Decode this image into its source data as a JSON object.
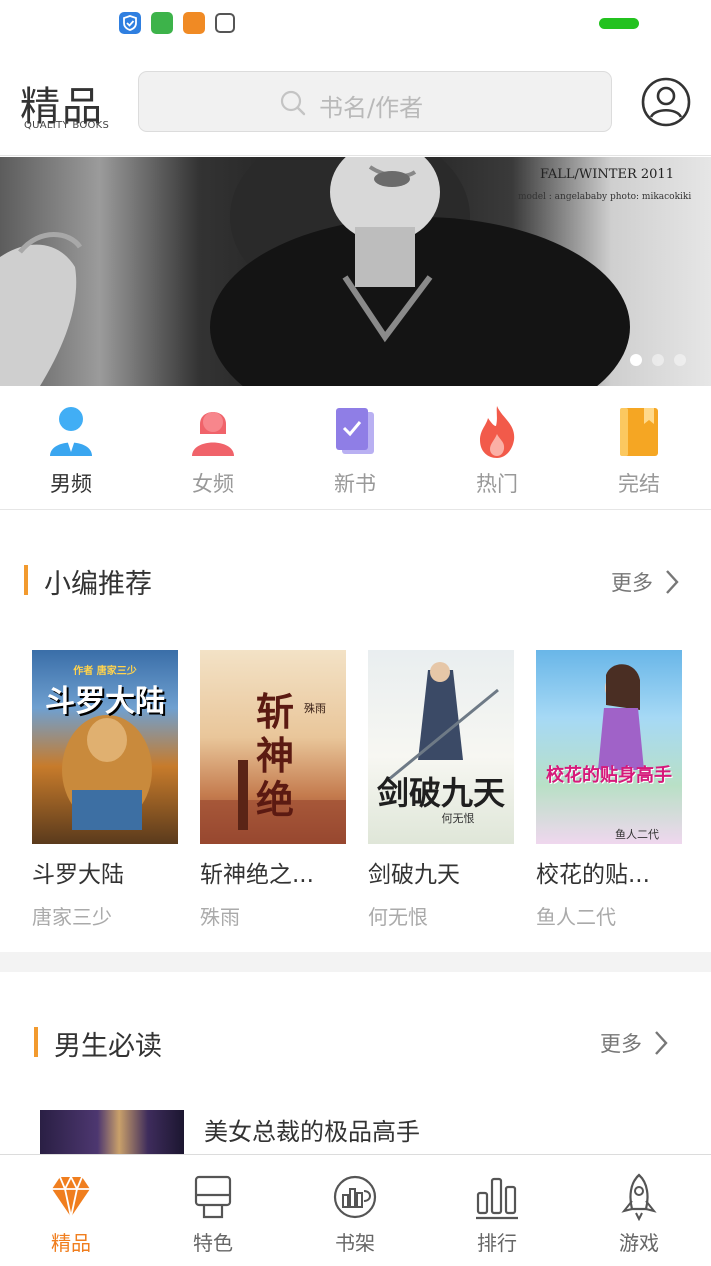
{
  "header": {
    "logo_text": "精品",
    "logo_subtitle": "QUALITY BOOKS",
    "search_placeholder": "书名/作者"
  },
  "banner": {
    "text_line1": "FALL/WINTER 2011",
    "text_line2": "model : angelababy    photo: mikacokiki",
    "slide_count": 3,
    "active_slide": 1
  },
  "categories": [
    {
      "label": "男频",
      "icon": "male-user-icon",
      "color": "#3aa6f0"
    },
    {
      "label": "女频",
      "icon": "female-user-icon",
      "color": "#f0636a"
    },
    {
      "label": "新书",
      "icon": "new-book-icon",
      "color": "#8f7ee6"
    },
    {
      "label": "热门",
      "icon": "flame-icon",
      "color": "#f25a4a"
    },
    {
      "label": "完结",
      "icon": "finished-book-icon",
      "color": "#f5a623"
    }
  ],
  "recommend": {
    "title": "小编推荐",
    "more": "更多",
    "books": [
      {
        "title": "斗罗大陆",
        "author": "唐家三少",
        "cover_text": "斗罗大陆",
        "cover_tag": "作者 唐家三少"
      },
      {
        "title": "斩神绝之...",
        "author": "殊雨",
        "cover_text": "斩神绝",
        "cover_tag": "殊雨"
      },
      {
        "title": "剑破九天",
        "author": "何无恨",
        "cover_text": "剑破九天",
        "cover_tag": "何无恨"
      },
      {
        "title": "校花的贴...",
        "author": "鱼人二代",
        "cover_text": "校花的贴身高手",
        "cover_tag": "鱼人二代"
      }
    ]
  },
  "must_read": {
    "title": "男生必读",
    "more": "更多",
    "first_item": "美女总裁的极品高手"
  },
  "bottom_nav": [
    {
      "label": "精品",
      "icon": "diamond-icon",
      "active": true
    },
    {
      "label": "特色",
      "icon": "feature-icon",
      "active": false
    },
    {
      "label": "书架",
      "icon": "bookshelf-icon",
      "active": false
    },
    {
      "label": "排行",
      "icon": "ranking-icon",
      "active": false
    },
    {
      "label": "游戏",
      "icon": "rocket-icon",
      "active": false
    }
  ],
  "colors": {
    "accent": "#f07e1e",
    "section_bar": "#f29a2e"
  }
}
